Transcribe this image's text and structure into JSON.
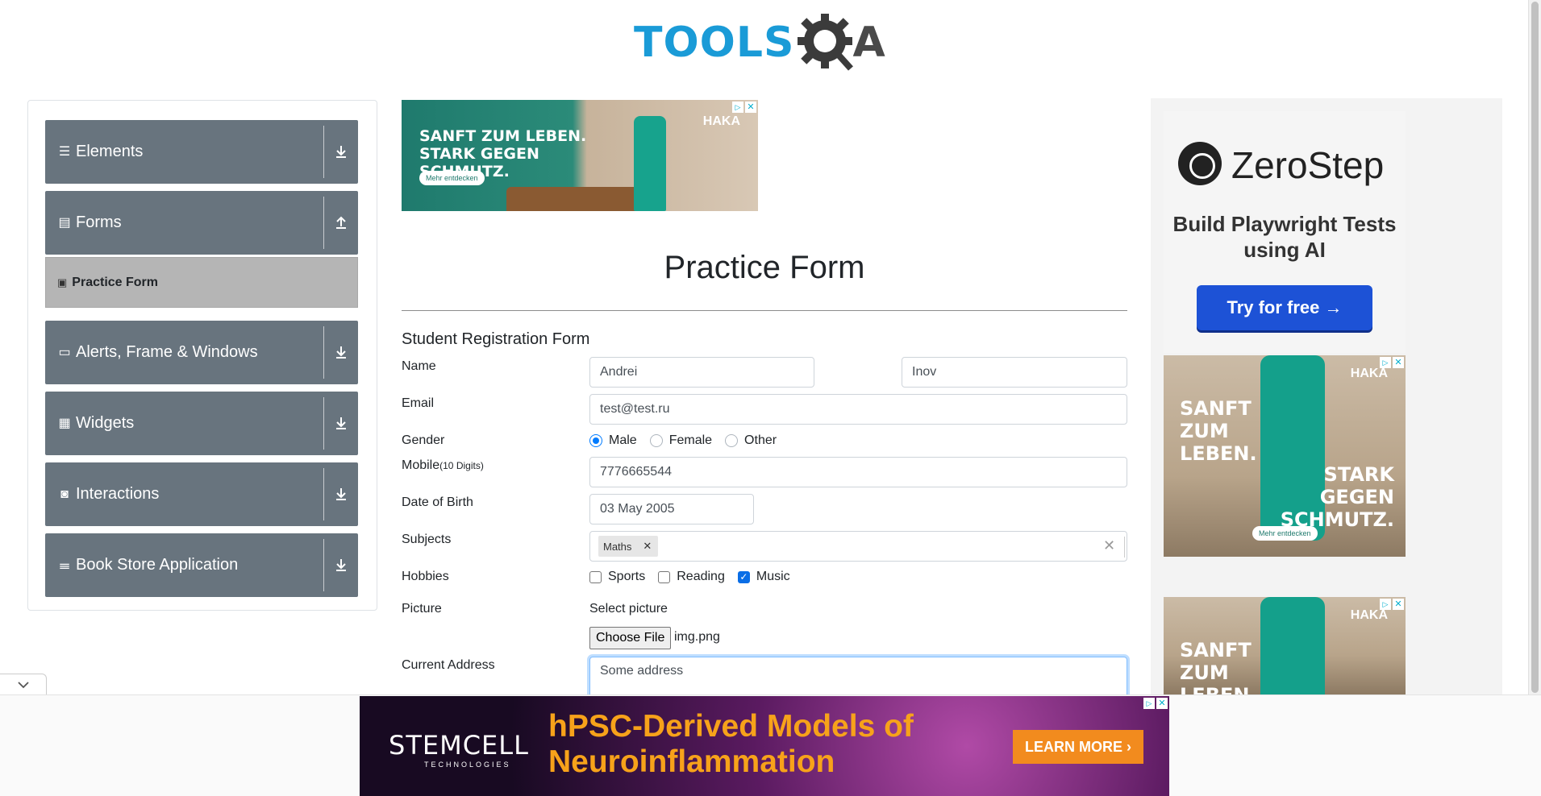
{
  "header": {
    "logo_text": "TOOLS",
    "logo_suffix": "A"
  },
  "sidebar": {
    "groups": [
      {
        "label": "Elements",
        "icon": "menu-icon",
        "toggle": "download-arrow-icon"
      },
      {
        "label": "Forms",
        "icon": "document-icon",
        "toggle": "upload-arrow-icon"
      },
      {
        "label": "Alerts, Frame & Windows",
        "icon": "window-icon",
        "toggle": "download-arrow-icon"
      },
      {
        "label": "Widgets",
        "icon": "widgets-icon",
        "toggle": "download-arrow-icon"
      },
      {
        "label": "Interactions",
        "icon": "interactions-icon",
        "toggle": "download-arrow-icon"
      },
      {
        "label": "Book Store Application",
        "icon": "books-icon",
        "toggle": "download-arrow-icon"
      }
    ],
    "active_item": "Practice Form"
  },
  "ads": {
    "top": {
      "headline": "SANFT ZUM LEBEN. STARK GEGEN SCHMUTZ.",
      "brand": "HAKA",
      "cta": "Mehr entdecken"
    },
    "zerostep": {
      "name": "ZeroStep",
      "tagline": "Build Playwright Tests using AI",
      "button": "Try for free →"
    },
    "haka_side": {
      "brand": "HAKA",
      "line1": "SANFT ZUM LEBEN.",
      "line2": "STARK GEGEN SCHMUTZ.",
      "cta": "Mehr entdecken"
    },
    "haka_side2": {
      "brand": "HAKA",
      "line1": "SANFT ZUM LEBEN."
    },
    "banner": {
      "logo": "STEMCELL",
      "sub": "TECHNOLOGIES",
      "headline": "hPSC-Derived Models of Neuroinflammation",
      "button": "LEARN MORE"
    }
  },
  "main": {
    "title": "Practice Form",
    "form_title": "Student Registration Form",
    "labels": {
      "name": "Name",
      "email": "Email",
      "gender": "Gender",
      "mobile": "Mobile",
      "mobile_hint": "(10 Digits)",
      "dob": "Date of Birth",
      "subjects": "Subjects",
      "hobbies": "Hobbies",
      "picture": "Picture",
      "select_picture": "Select picture",
      "address": "Current Address"
    },
    "values": {
      "first_name": "Andrei",
      "last_name": "Inov",
      "email": "test@test.ru",
      "mobile": "7776665544",
      "dob": "03 May 2005",
      "subject_chip": "Maths",
      "file_button": "Choose File",
      "file_name": "img.png",
      "address": "Some address"
    },
    "gender_options": [
      "Male",
      "Female",
      "Other"
    ],
    "gender_selected": "Male",
    "hobbies": [
      "Sports",
      "Reading",
      "Music"
    ],
    "hobbies_checked": [
      "Music"
    ]
  }
}
